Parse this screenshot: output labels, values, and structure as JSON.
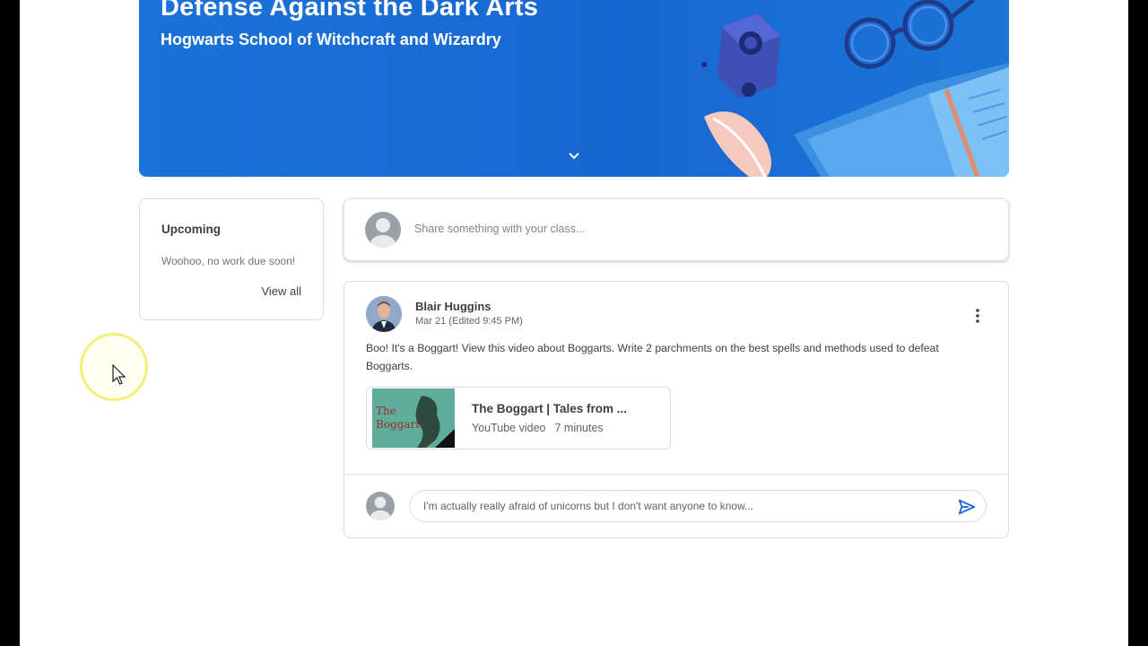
{
  "banner": {
    "title": "Defense Against the Dark Arts",
    "subtitle": "Hogwarts School of Witchcraft and Wizardry",
    "color": "#1967d2"
  },
  "upcoming": {
    "title": "Upcoming",
    "empty_text": "Woohoo, no work due soon!",
    "view_all": "View all"
  },
  "share": {
    "placeholder": "Share something with your class..."
  },
  "post": {
    "author": "Blair Huggins",
    "date": "Mar 21 (Edited 9:45 PM)",
    "body": "Boo! It's a Boggart! View this video about Boggarts. Write 2 parchments on the best spells and methods used to defeat Boggarts.",
    "attachment": {
      "title": "The Boggart | Tales from ...",
      "type": "YouTube video",
      "duration": "7 minutes",
      "thumbnail_text": "The Boggart"
    },
    "comment": {
      "text": "I'm actually really afraid of unicorns but I don't want anyone to know..."
    }
  },
  "icons": {
    "menu": "more-vert-icon",
    "send": "send-icon",
    "expand": "chevron-down-icon"
  }
}
